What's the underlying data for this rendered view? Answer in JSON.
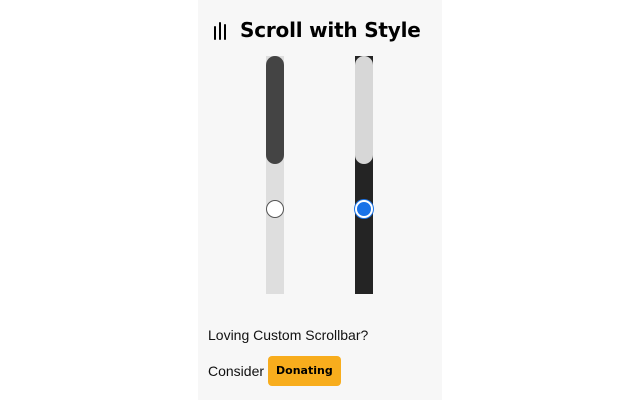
{
  "app": {
    "title": "Scroll with Style"
  },
  "header": {
    "logo_icon": "scroll-bars-icon"
  },
  "previews": [
    {
      "theme": "light",
      "selected": false,
      "track_color": "#dedede",
      "thumb_color": "#444444"
    },
    {
      "theme": "dark",
      "selected": true,
      "track_color": "#242424",
      "thumb_color": "#d7d7d7"
    }
  ],
  "footer": {
    "loving_text": "Loving Custom Scrollbar?",
    "consider_text": "Consider",
    "donate_label": "Donating"
  },
  "colors": {
    "accent": "#1a73e8",
    "donate": "#f8ad1d",
    "popup_background": "#f7f7f7"
  }
}
